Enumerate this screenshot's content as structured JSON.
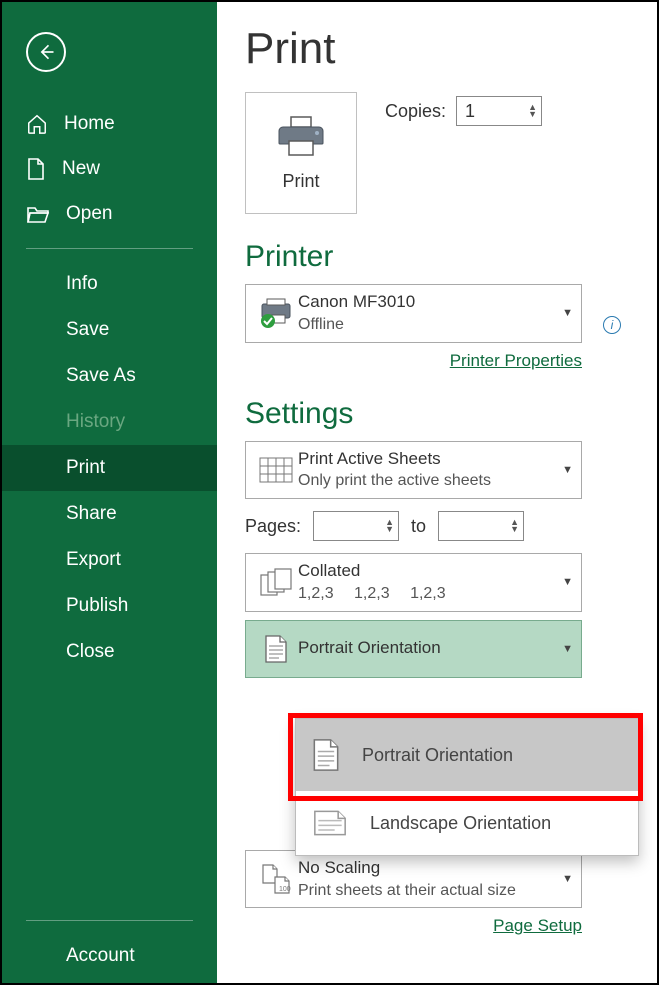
{
  "sidebar": {
    "items": [
      {
        "label": "Home"
      },
      {
        "label": "New"
      },
      {
        "label": "Open"
      }
    ],
    "sub": [
      {
        "label": "Info"
      },
      {
        "label": "Save"
      },
      {
        "label": "Save As"
      },
      {
        "label": "History"
      },
      {
        "label": "Print"
      },
      {
        "label": "Share"
      },
      {
        "label": "Export"
      },
      {
        "label": "Publish"
      },
      {
        "label": "Close"
      }
    ],
    "bottom": {
      "account": "Account"
    }
  },
  "main": {
    "title": "Print",
    "printButton": "Print",
    "copiesLabel": "Copies:",
    "copiesValue": "1",
    "printerHeading": "Printer",
    "printer": {
      "name": "Canon MF3010",
      "status": "Offline"
    },
    "printerPropertiesLink": "Printer Properties",
    "settingsHeading": "Settings",
    "printActive": {
      "title": "Print Active Sheets",
      "sub": "Only print the active sheets"
    },
    "pagesLabel": "Pages:",
    "pagesTo": "to",
    "collated": {
      "title": "Collated",
      "sub": "1,2,3  1,2,3  1,2,3"
    },
    "orientation": {
      "title": "Portrait Orientation"
    },
    "orientationOptions": {
      "portrait": "Portrait Orientation",
      "landscape": "Landscape Orientation"
    },
    "scaling": {
      "title": "No Scaling",
      "sub": "Print sheets at their actual size"
    },
    "pageSetupLink": "Page Setup"
  }
}
